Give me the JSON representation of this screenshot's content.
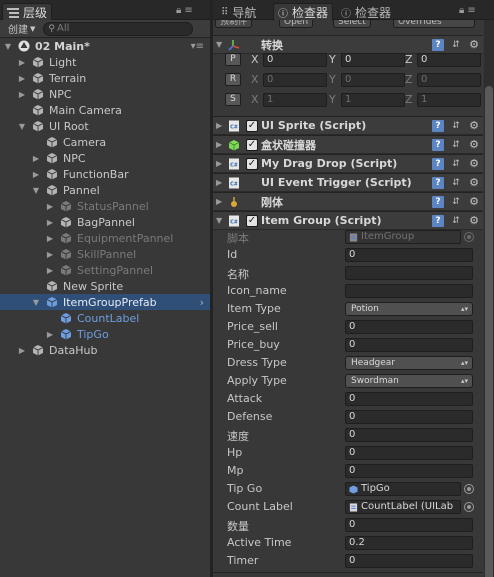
{
  "hierarchy": {
    "tab_label": "层级",
    "create_label": "创建",
    "search_placeholder": "All",
    "scene_name": "02 Main*",
    "items": [
      {
        "label": "Light",
        "depth": 1,
        "fold": "collapsed",
        "style": "normal"
      },
      {
        "label": "Terrain",
        "depth": 1,
        "fold": "collapsed",
        "style": "normal"
      },
      {
        "label": "NPC",
        "depth": 1,
        "fold": "collapsed",
        "style": "normal"
      },
      {
        "label": "Main Camera",
        "depth": 1,
        "fold": "none",
        "style": "normal"
      },
      {
        "label": "UI Root",
        "depth": 1,
        "fold": "expanded",
        "style": "normal"
      },
      {
        "label": "Camera",
        "depth": 2,
        "fold": "none",
        "style": "normal"
      },
      {
        "label": "NPC",
        "depth": 2,
        "fold": "collapsed",
        "style": "normal"
      },
      {
        "label": "FunctionBar",
        "depth": 2,
        "fold": "collapsed",
        "style": "normal"
      },
      {
        "label": "Pannel",
        "depth": 2,
        "fold": "expanded",
        "style": "normal"
      },
      {
        "label": "StatusPannel",
        "depth": 3,
        "fold": "collapsed",
        "style": "dim"
      },
      {
        "label": "BagPannel",
        "depth": 3,
        "fold": "collapsed",
        "style": "normal"
      },
      {
        "label": "EquipmentPannel",
        "depth": 3,
        "fold": "collapsed",
        "style": "dim"
      },
      {
        "label": "SkillPannel",
        "depth": 3,
        "fold": "collapsed",
        "style": "dim"
      },
      {
        "label": "SettingPannel",
        "depth": 3,
        "fold": "collapsed",
        "style": "dim"
      },
      {
        "label": "New Sprite",
        "depth": 2,
        "fold": "none",
        "style": "normal"
      },
      {
        "label": "ItemGroupPrefab",
        "depth": 2,
        "fold": "expanded",
        "style": "prefab-selected"
      },
      {
        "label": "CountLabel",
        "depth": 3,
        "fold": "none",
        "style": "blue"
      },
      {
        "label": "TipGo",
        "depth": 3,
        "fold": "collapsed",
        "style": "blue"
      },
      {
        "label": "DataHub",
        "depth": 1,
        "fold": "collapsed",
        "style": "normal"
      }
    ]
  },
  "inspector": {
    "tabs": [
      {
        "label": "导航",
        "icon": "navigation-icon",
        "active": false
      },
      {
        "label": "检查器",
        "icon": "info-icon",
        "active": true
      },
      {
        "label": "检查器",
        "icon": "info-icon",
        "active": false
      }
    ],
    "peek_buttons": [
      "预制件",
      "Open",
      "Select",
      "Overrides"
    ],
    "transform": {
      "title": "转换",
      "rows": [
        {
          "btn": "P",
          "x": "0",
          "y": "0",
          "z": "0",
          "dim": false
        },
        {
          "btn": "R",
          "x": "0",
          "y": "0",
          "z": "0",
          "dim": true
        },
        {
          "btn": "S",
          "x": "1",
          "y": "1",
          "z": "1",
          "dim": true
        }
      ],
      "axis_labels": [
        "X",
        "Y",
        "Z"
      ]
    },
    "components": [
      {
        "title": "UI Sprite (Script)",
        "icon": "script-icon",
        "checkbox": true
      },
      {
        "title": "盒状碰撞器",
        "icon": "box-collider-icon",
        "checkbox": true
      },
      {
        "title": "My Drag Drop (Script)",
        "icon": "script-icon",
        "checkbox": true
      },
      {
        "title": "UI Event Trigger (Script)",
        "icon": "script-icon",
        "checkbox": false
      },
      {
        "title": "刚体",
        "icon": "rigidbody-icon",
        "checkbox": false
      },
      {
        "title": "Item Group (Script)",
        "icon": "script-icon",
        "checkbox": true
      }
    ],
    "item_group": {
      "fields": [
        {
          "label": "脚本",
          "value": "ItemGroup",
          "kind": "object-dim"
        },
        {
          "label": "Id",
          "value": "0",
          "kind": "text"
        },
        {
          "label": "名称",
          "value": "",
          "kind": "text"
        },
        {
          "label": "Icon_name",
          "value": "",
          "kind": "text"
        },
        {
          "label": "Item Type",
          "value": "Potion",
          "kind": "dropdown"
        },
        {
          "label": "Price_sell",
          "value": "0",
          "kind": "text"
        },
        {
          "label": "Price_buy",
          "value": "0",
          "kind": "text"
        },
        {
          "label": "Dress Type",
          "value": "Headgear",
          "kind": "dropdown"
        },
        {
          "label": "Apply Type",
          "value": "Swordman",
          "kind": "dropdown"
        },
        {
          "label": "Attack",
          "value": "0",
          "kind": "text"
        },
        {
          "label": "Defense",
          "value": "0",
          "kind": "text"
        },
        {
          "label": "速度",
          "value": "0",
          "kind": "text"
        },
        {
          "label": "Hp",
          "value": "0",
          "kind": "text"
        },
        {
          "label": "Mp",
          "value": "0",
          "kind": "text"
        },
        {
          "label": "Tip Go",
          "value": "TipGo",
          "kind": "object"
        },
        {
          "label": "Count Label",
          "value": "CountLabel (UILab",
          "kind": "object"
        },
        {
          "label": "数量",
          "value": "0",
          "kind": "text"
        },
        {
          "label": "Active Time",
          "value": "0.2",
          "kind": "text"
        },
        {
          "label": "Timer",
          "value": "0",
          "kind": "text"
        }
      ]
    }
  },
  "colors": {
    "panel_bg": "#383838",
    "selection": "#2f4f78",
    "prefab_blue": "#6f9ee0",
    "help_icon": "#5b86c3"
  }
}
